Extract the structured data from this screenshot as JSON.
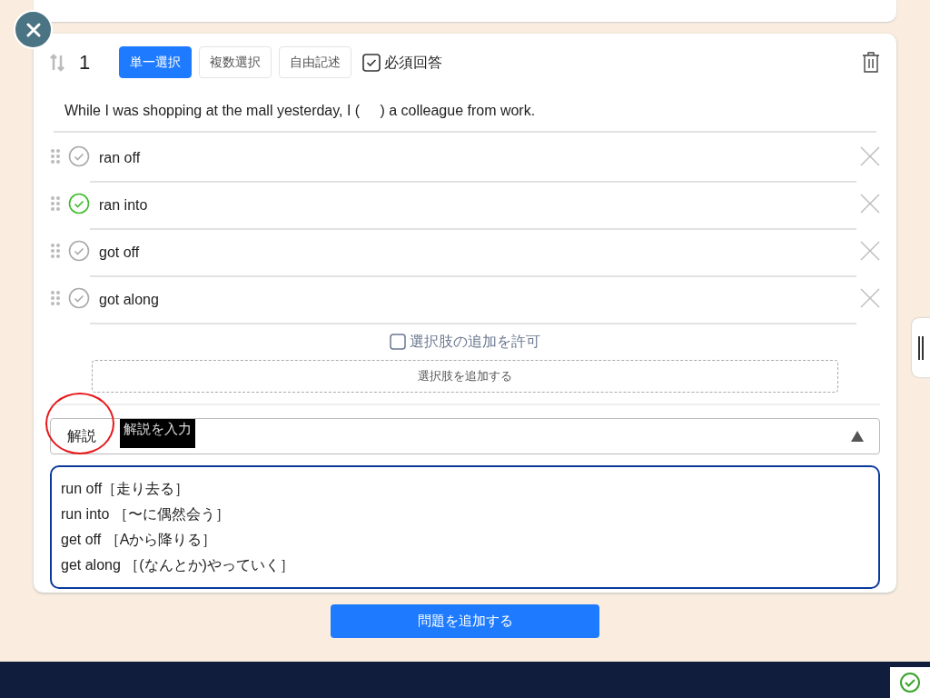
{
  "question": {
    "number": "1",
    "types": [
      {
        "label": "単一選択",
        "selected": true
      },
      {
        "label": "複数選択",
        "selected": false
      },
      {
        "label": "自由記述",
        "selected": false
      }
    ],
    "required": {
      "label": "必須回答",
      "checked": true
    },
    "text": "While I was shopping at the mall yesterday, I (     ) a colleague from work.",
    "choices": [
      {
        "text": "ran off",
        "correct": false
      },
      {
        "text": "ran into",
        "correct": true
      },
      {
        "text": "got off",
        "correct": false
      },
      {
        "text": "got along",
        "correct": false
      }
    ],
    "allow_add": {
      "label": "選択肢の追加を許可",
      "checked": false
    },
    "add_choice_button": "選択肢を追加する",
    "explanation": {
      "label": "解説",
      "placeholder": "解説を入力",
      "expanded": true,
      "lines": [
        "run off［走り去る］",
        "run into ［〜に偶然会う］",
        "get off ［Aから降りる］",
        "get along ［(なんとか)やっていく］"
      ]
    }
  },
  "add_question_button": "問題を追加する"
}
